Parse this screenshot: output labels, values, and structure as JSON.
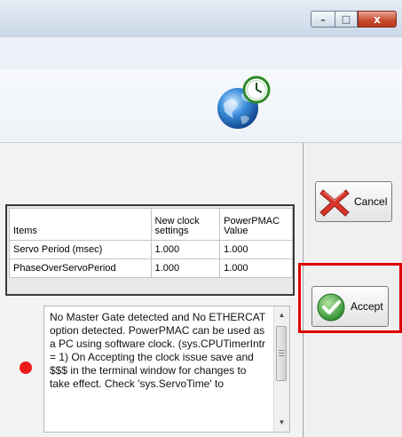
{
  "window": {
    "minimize_glyph": "–",
    "maximize_glyph": "□",
    "close_glyph": "x"
  },
  "banner": {
    "icon": "globe-clock-icon"
  },
  "clock_table": {
    "headers": [
      "Items",
      "New clock settings",
      "PowerPMAC Value"
    ],
    "rows": [
      {
        "item": "Servo Period (msec)",
        "new": "1.000",
        "value": "1.000"
      },
      {
        "item": "PhaseOverServoPeriod",
        "new": "1.000",
        "value": "1.000"
      }
    ]
  },
  "message": {
    "text": "No Master Gate detected and No ETHERCAT option detected. PowerPMAC can be used as a PC using software clock. (sys.CPUTimerIntr = 1) On Accepting the clock issue save and $$$ in the terminal window for changes to take effect. Check 'sys.ServoTime' to",
    "indicator_color": "#ee1a1a"
  },
  "buttons": {
    "cancel_label": "Cancel",
    "accept_label": "Accept"
  },
  "highlight_color": "#e00000"
}
